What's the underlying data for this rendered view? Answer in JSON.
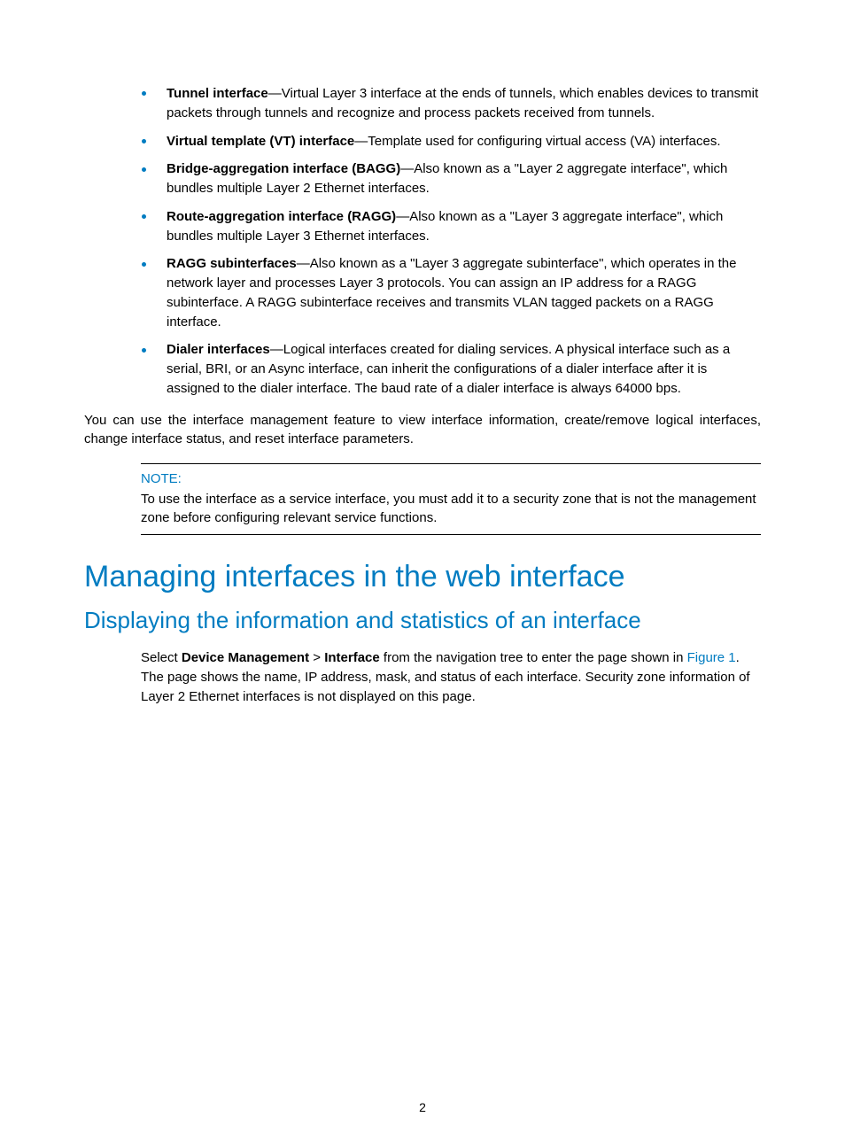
{
  "definitions": [
    {
      "term": "Tunnel interface",
      "desc": "—Virtual Layer 3 interface at the ends of tunnels, which enables devices to transmit packets through tunnels and recognize and process packets received from tunnels."
    },
    {
      "term": "Virtual template (VT) interface",
      "desc": "—Template used for configuring virtual access (VA) interfaces."
    },
    {
      "term": "Bridge-aggregation interface (BAGG)",
      "desc": "—Also known as a \"Layer 2 aggregate interface\", which bundles multiple Layer 2 Ethernet interfaces."
    },
    {
      "term": "Route-aggregation interface (RAGG)",
      "desc": "—Also known as a \"Layer 3 aggregate interface\", which bundles multiple Layer 3 Ethernet interfaces."
    },
    {
      "term": "RAGG subinterfaces",
      "desc": "—Also known as a \"Layer 3 aggregate subinterface\", which operates in the network layer and processes Layer 3 protocols. You can assign an IP address for a RAGG subinterface. A RAGG subinterface receives and transmits VLAN tagged packets on a RAGG interface."
    },
    {
      "term": "Dialer interfaces",
      "desc": "—Logical interfaces created for dialing services. A physical interface such as a serial, BRI, or an Async interface, can inherit the configurations of a dialer interface after it is assigned to the dialer interface. The baud rate of a dialer interface is always 64000 bps."
    }
  ],
  "body_paragraph": "You can use the interface management feature to view interface information, create/remove logical interfaces, change interface status, and reset interface parameters.",
  "note": {
    "title": "NOTE:",
    "body": "To use the interface as a service interface, you must add it to a security zone that is not the management zone before configuring relevant service functions."
  },
  "h1": "Managing interfaces in the web interface",
  "h2": "Displaying the information and statistics of an interface",
  "step": {
    "pre": "Select ",
    "nav1": "Device Management",
    "sep": " > ",
    "nav2": "Interface",
    "post1": " from the navigation tree to enter the page shown in ",
    "figlink": "Figure 1",
    "post2": ". The page shows the name, IP address, mask, and status of each interface. Security zone information of Layer 2 Ethernet interfaces is not displayed on this page."
  },
  "page_number": "2"
}
